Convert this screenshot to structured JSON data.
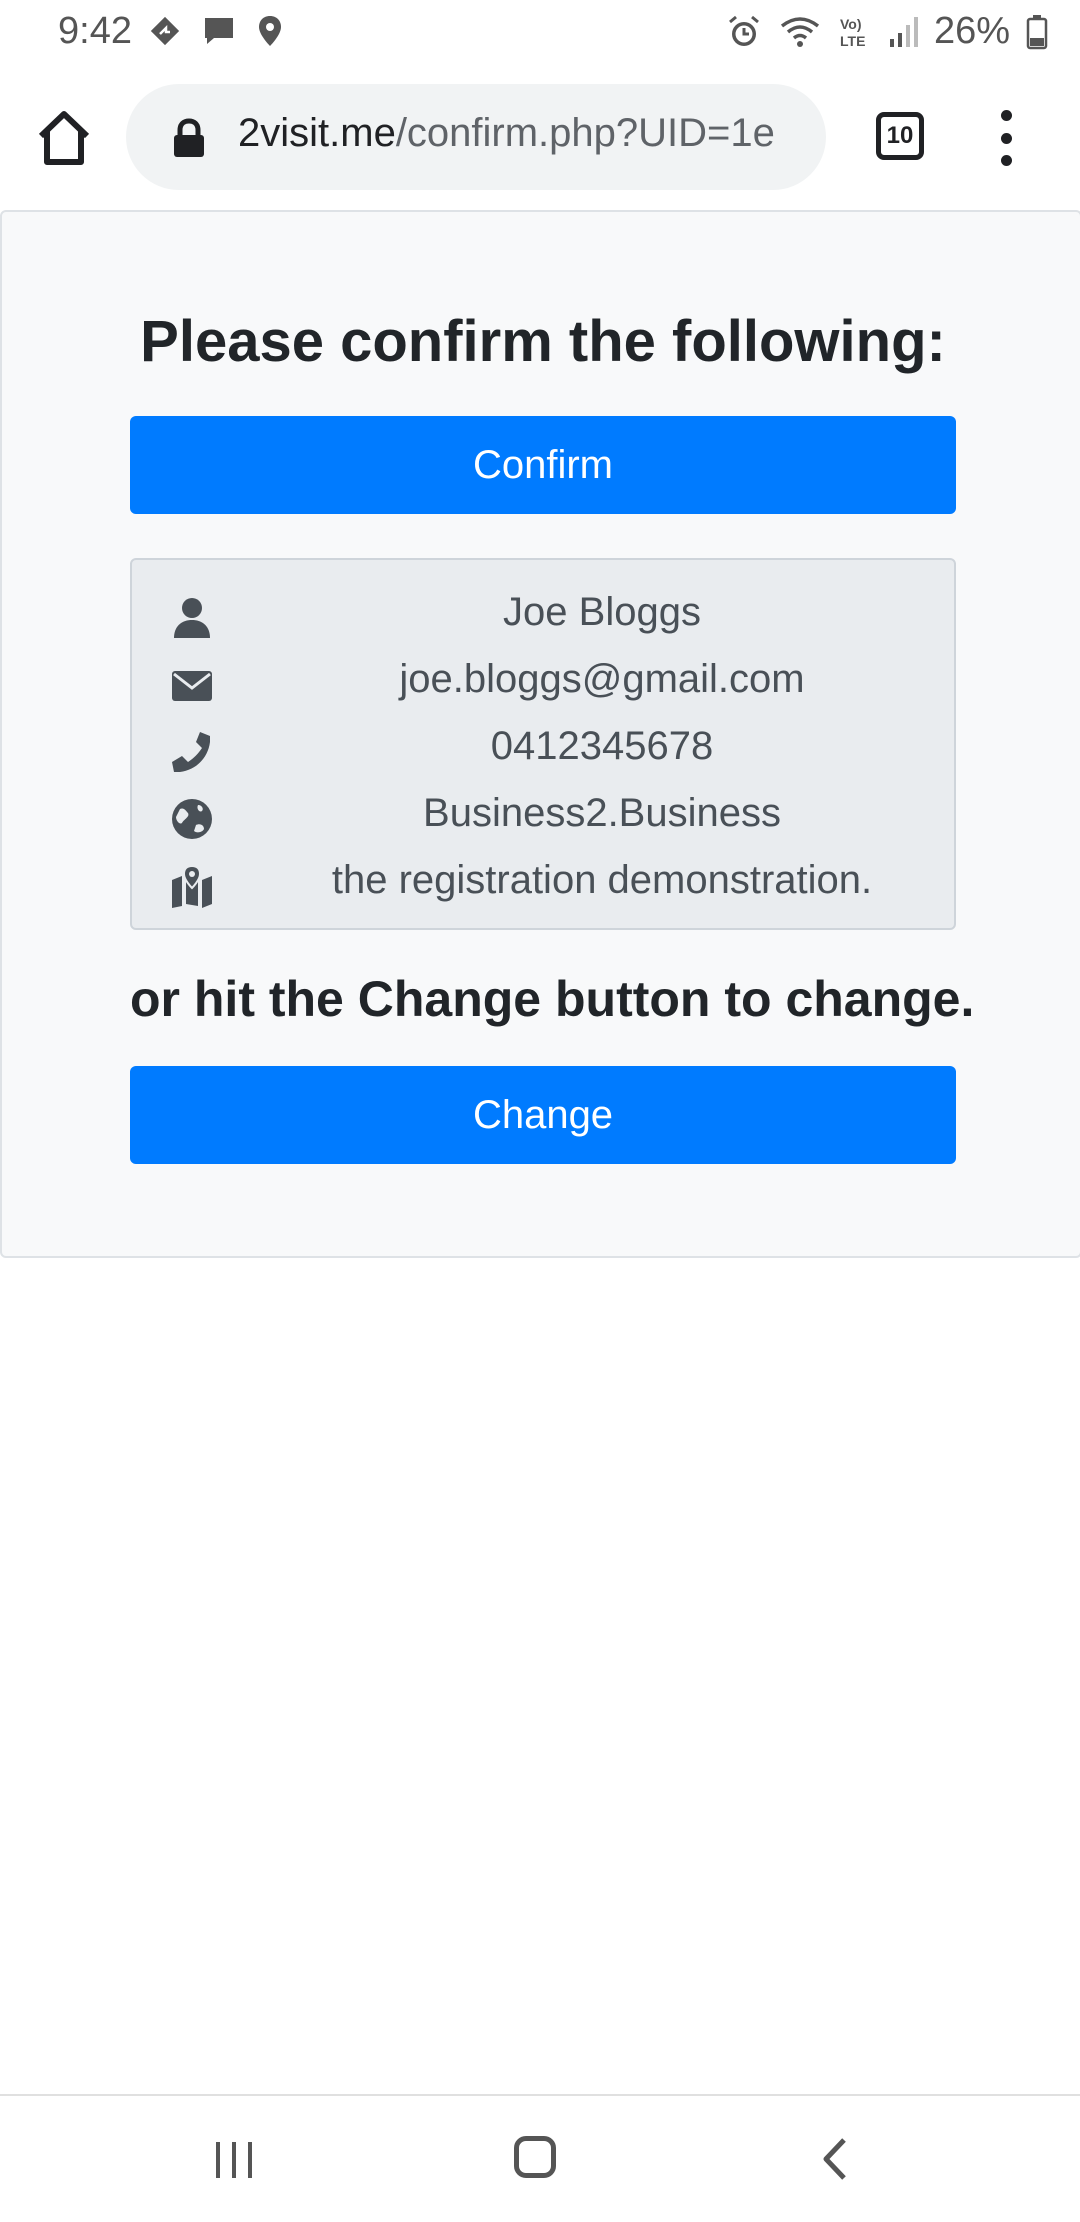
{
  "status_bar": {
    "time": "9:42",
    "battery": "26%",
    "icons_left": [
      "navigation-icon",
      "message-icon",
      "location-icon"
    ],
    "icons_right": [
      "alarm-icon",
      "wifi-icon",
      "volte-icon",
      "signal-icon",
      "battery-icon"
    ]
  },
  "browser": {
    "url_host": "2visit.me",
    "url_path": "/confirm.php?UID=1e",
    "tab_count": "10"
  },
  "page": {
    "heading": "Please confirm the following:",
    "confirm_label": "Confirm",
    "details": [
      {
        "icon": "user-icon",
        "text": "Joe Bloggs"
      },
      {
        "icon": "envelope-icon",
        "text": "joe.bloggs@gmail.com"
      },
      {
        "icon": "phone-icon",
        "text": "0412345678"
      },
      {
        "icon": "globe-icon",
        "text": "Business2.Business"
      },
      {
        "icon": "map-marked-icon",
        "text": "the registration demonstration."
      }
    ],
    "change_prompt": "or hit the Change button to change.",
    "change_label": "Change"
  },
  "colors": {
    "primary": "#007bff",
    "card_bg": "#f8f9fa",
    "info_bg": "#e9ecef"
  }
}
